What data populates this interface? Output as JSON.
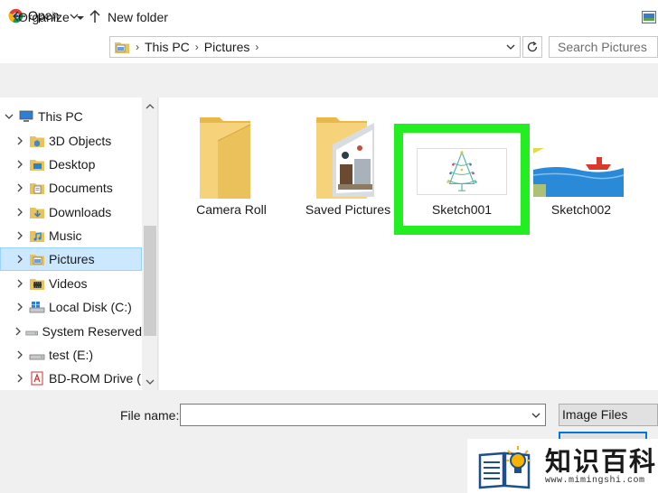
{
  "window": {
    "title": "Open"
  },
  "address": {
    "crumbs": [
      "This PC",
      "Pictures"
    ],
    "search_placeholder": "Search Pictures"
  },
  "toolbar": {
    "organize_label": "Organize",
    "new_folder_label": "New folder"
  },
  "nav": {
    "items": [
      {
        "label": "This PC",
        "icon": "pc-icon",
        "expanded": true
      },
      {
        "label": "3D Objects",
        "icon": "3d-objects-icon"
      },
      {
        "label": "Desktop",
        "icon": "desktop-icon"
      },
      {
        "label": "Documents",
        "icon": "documents-icon"
      },
      {
        "label": "Downloads",
        "icon": "downloads-icon"
      },
      {
        "label": "Music",
        "icon": "music-icon"
      },
      {
        "label": "Pictures",
        "icon": "pictures-icon",
        "selected": true
      },
      {
        "label": "Videos",
        "icon": "videos-icon"
      },
      {
        "label": "Local Disk (C:)",
        "icon": "local-disk-icon"
      },
      {
        "label": "System Reserved",
        "icon": "drive-icon"
      },
      {
        "label": "test (E:)",
        "icon": "drive-icon"
      },
      {
        "label": "BD-ROM Drive (",
        "icon": "bd-rom-icon"
      }
    ]
  },
  "content": {
    "items": [
      {
        "label": "Camera Roll",
        "type": "folder"
      },
      {
        "label": "Saved Pictures",
        "type": "folder-with-photo"
      },
      {
        "label": "Sketch001",
        "type": "image",
        "highlighted": true
      },
      {
        "label": "Sketch002",
        "type": "image"
      }
    ]
  },
  "footer": {
    "file_name_label": "File name:",
    "file_name_value": "",
    "file_type_value": "Image Files"
  },
  "watermark": {
    "text": "知识百科",
    "url": "www.mimingshi.com"
  },
  "colors": {
    "highlight": "#22ee22",
    "selection": "#cce8ff",
    "accent": "#0078d7"
  }
}
